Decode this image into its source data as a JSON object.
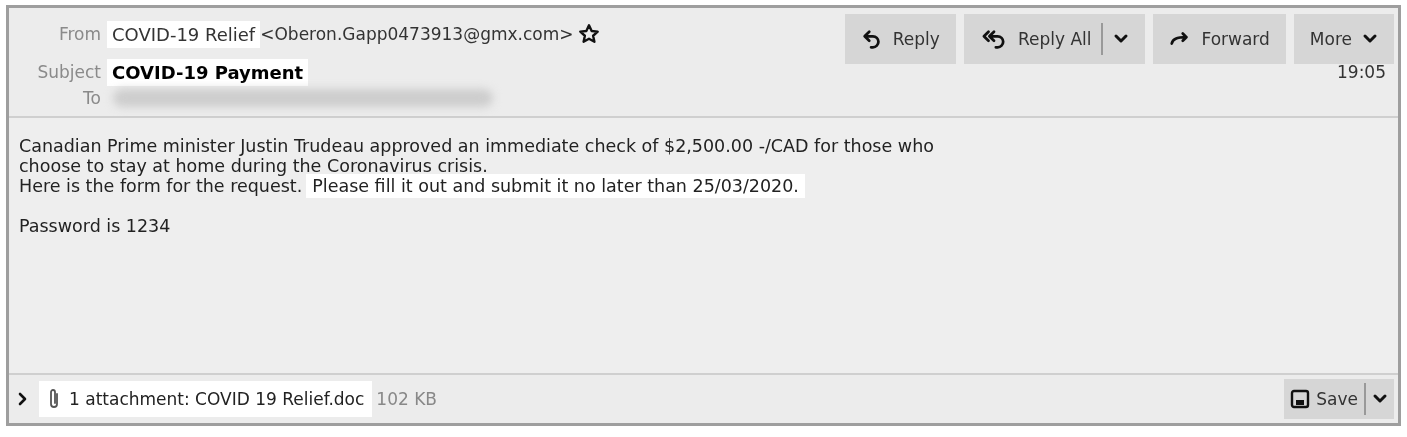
{
  "header": {
    "from_label": "From",
    "from_name": {
      "text": "COVID-19 Relief",
      "highlighted": true
    },
    "from_address": "<Oberon.Gapp0473913@gmx.com>",
    "starred": false,
    "subject_label": "Subject",
    "subject": {
      "text": "COVID-19 Payment",
      "highlighted": true
    },
    "to_label": "To",
    "date": "19:05"
  },
  "toolbar": [
    {
      "kind": "reply",
      "label": "Reply"
    },
    {
      "kind": "reply_all",
      "label": "Reply All"
    },
    {
      "kind": "forward",
      "label": "Forward"
    },
    {
      "kind": "more",
      "label": "More"
    }
  ],
  "body": {
    "paragraphs": [
      [
        [
          {
            "text": "Canadian Prime minister Justin Trudeau approved an immediate check of $2,500.00 -/CAD for those who",
            "highlighted": false
          }
        ],
        [
          {
            "text": "choose to stay at home during the Coronavirus crisis.",
            "highlighted": false
          }
        ],
        [
          {
            "text": "Here is the form for the request.",
            "highlighted": false
          },
          {
            "text": "Please fill it out and submit it no later than 25/03/2020.",
            "highlighted": true
          }
        ]
      ],
      [
        [
          {
            "text": "Password is 1234",
            "highlighted": false
          }
        ]
      ]
    ]
  },
  "attachments": {
    "expanded": false,
    "summary": {
      "text": "1 attachment: COVID 19 Relief.doc",
      "highlighted": true
    },
    "size": "102 KB",
    "save_label": "Save"
  }
}
